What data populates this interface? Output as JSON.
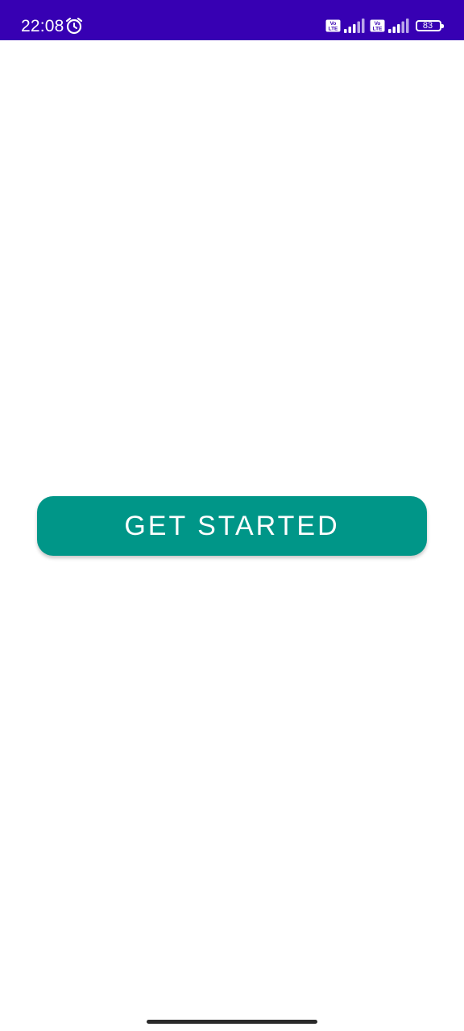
{
  "status_bar": {
    "time": "22:08",
    "icons": [
      "alarm-icon",
      "volte-icon",
      "signal-icon",
      "volte-icon",
      "signal-icon",
      "battery-icon"
    ],
    "battery_level": "83",
    "background_color": "#3700b3"
  },
  "main": {
    "get_started_label": "GET STARTED",
    "accent_color": "#009688"
  },
  "navigation": {
    "handle_icon": "gesture-handle"
  }
}
